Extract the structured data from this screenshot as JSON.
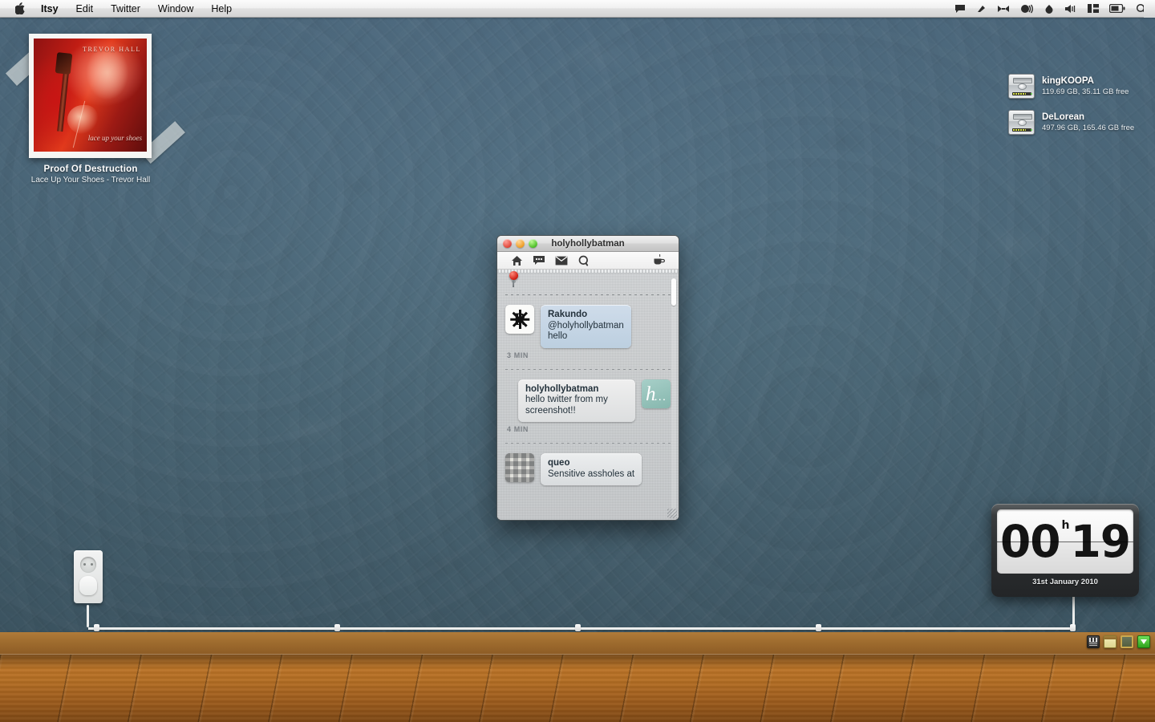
{
  "menubar": {
    "apple_icon": "apple-logo",
    "items": [
      {
        "label": "Itsy",
        "bold": true
      },
      {
        "label": "Edit",
        "bold": false
      },
      {
        "label": "Twitter",
        "bold": false
      },
      {
        "label": "Window",
        "bold": false
      },
      {
        "label": "Help",
        "bold": false
      }
    ],
    "status_icons": [
      "chat-bubble-icon",
      "flag-icon",
      "bowtie-icon",
      "sound-wave-icon",
      "droplet-icon",
      "volume-icon",
      "spaces-icon",
      "battery-icon",
      "spotlight-search-icon"
    ]
  },
  "album_widget": {
    "cover_artist": "TREVOR HALL",
    "cover_caption": "lace up your shoes",
    "song_title": "Proof Of Destruction",
    "song_subtitle": "Lace Up Your Shoes - Trevor Hall"
  },
  "drives": [
    {
      "name": "kingKOOPA",
      "info": "119.69 GB, 35.11 GB free",
      "icon": "hard-drive-icon"
    },
    {
      "name": "DeLorean",
      "info": "497.96 GB, 165.46 GB free",
      "icon": "hard-drive-icon"
    }
  ],
  "itsy_window": {
    "title": "holyhollybatman",
    "traffic_lights": [
      "close",
      "minimize",
      "zoom"
    ],
    "toolbar_icons": [
      "home-icon",
      "replies-bubble-icon",
      "messages-envelope-icon",
      "search-icon",
      "coffee-cup-icon"
    ],
    "pin_icon": "pin-icon",
    "tweets": [
      {
        "kind": "incoming",
        "avatar": "rakundo-avatar",
        "author": "Rakundo",
        "handle": "@holyhollybatman",
        "text": "hello",
        "timestamp": "3 MIN"
      },
      {
        "kind": "outgoing",
        "avatar": "holyhollybatman-avatar",
        "author": "holyhollybatman",
        "handle": "",
        "text": "hello twitter from my screenshot!!",
        "timestamp": "4 MIN"
      },
      {
        "kind": "incoming",
        "avatar": "queo-avatar",
        "author": "queo",
        "handle": "",
        "text": "Sensitive assholes at",
        "timestamp": ""
      }
    ]
  },
  "clock_widget": {
    "hours": "00",
    "separator": "h",
    "minutes": "19",
    "date": "31st January 2010"
  },
  "shelf_icons": [
    "stack-widget-icon",
    "notes-icon",
    "chalkboard-icon",
    "download-icon"
  ],
  "colors": {
    "wall": "#4a6a80",
    "floor": "#b46e24",
    "baseboard": "#a06d2f",
    "bubble_incoming": "#c5d5e6",
    "bubble_outgoing": "#e5e7e8",
    "avatar_teal": "#96c3bb",
    "pin_red": "#d02318"
  }
}
